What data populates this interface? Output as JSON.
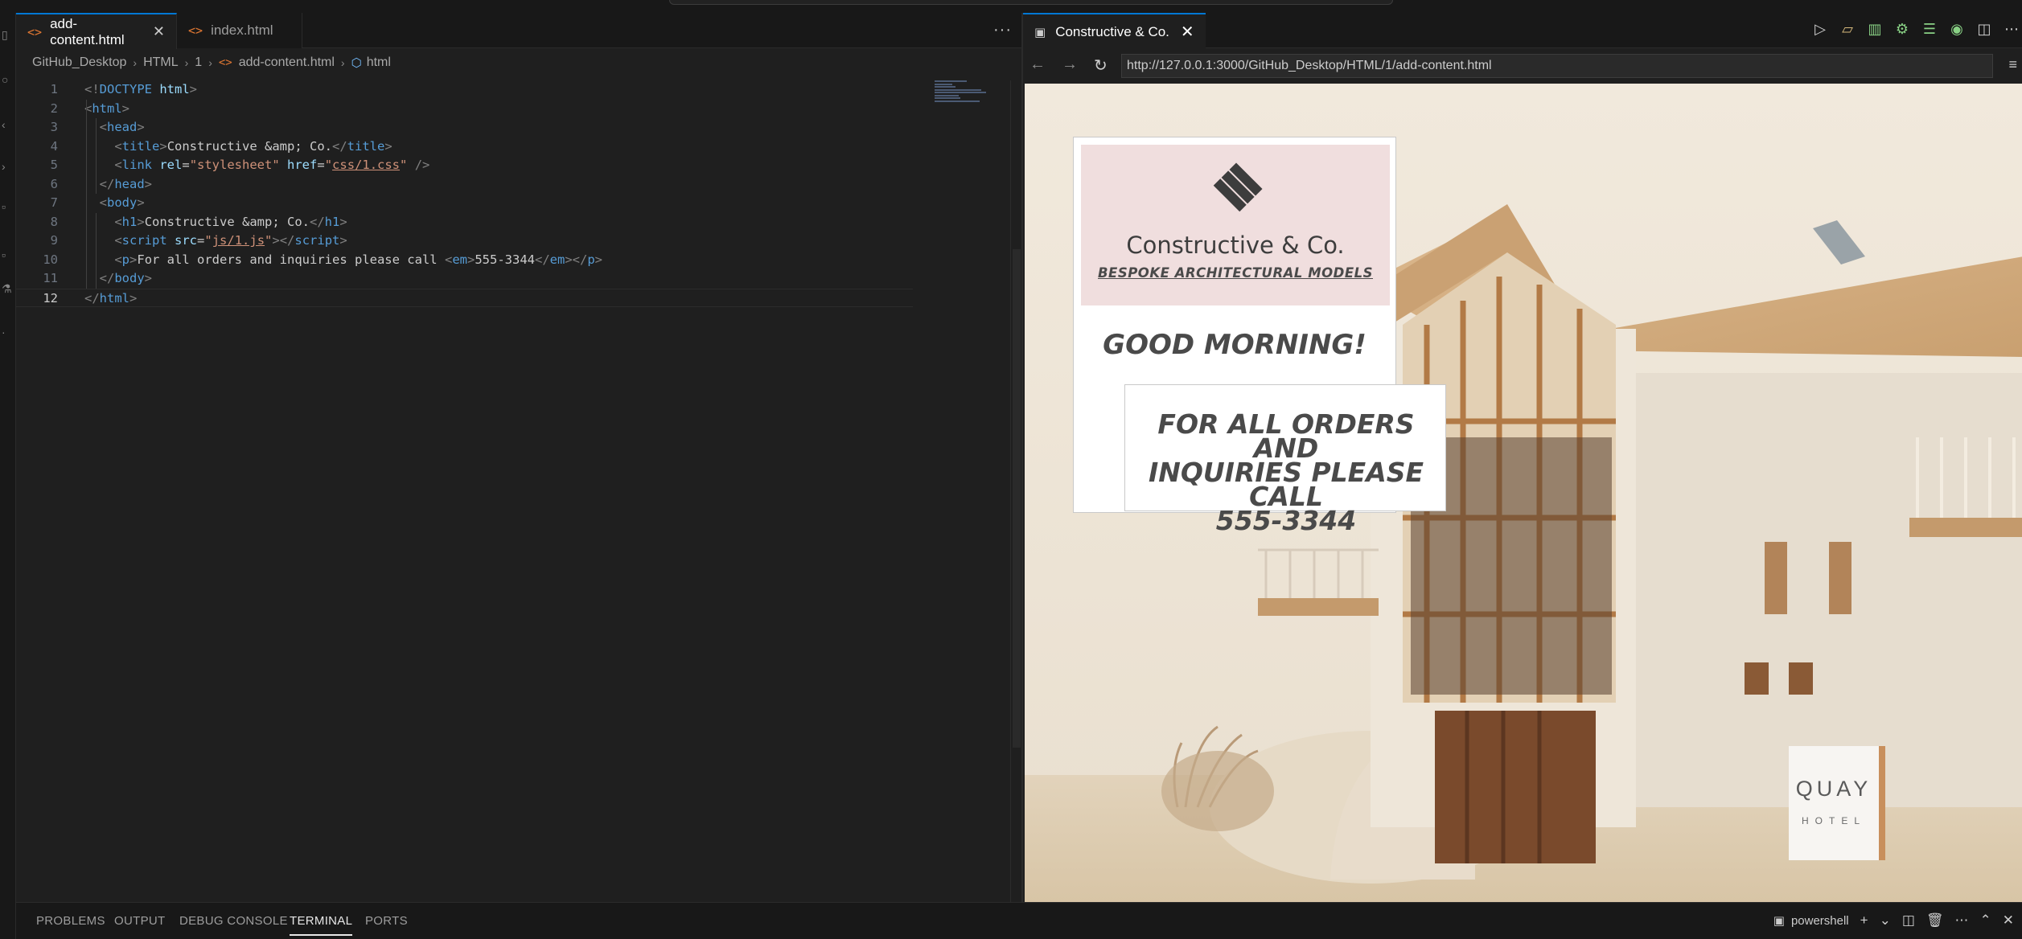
{
  "editor": {
    "tabs": [
      {
        "label": "add-content.html",
        "active": true
      },
      {
        "label": "index.html",
        "active": false
      }
    ],
    "more_label": "···",
    "breadcrumb": [
      "GitHub_Desktop",
      "HTML",
      "1",
      "add-content.html",
      "html"
    ],
    "lines": [
      {
        "n": "1",
        "parts": [
          [
            "punc",
            "<!"
          ],
          [
            "tag",
            "DOCTYPE"
          ],
          [
            "txtc",
            " "
          ],
          [
            "attr",
            "html"
          ],
          [
            "punc",
            ">"
          ]
        ]
      },
      {
        "n": "2",
        "parts": [
          [
            "punc",
            "<"
          ],
          [
            "tag",
            "html"
          ],
          [
            "punc",
            ">"
          ]
        ]
      },
      {
        "n": "3",
        "parts": [
          [
            "txtc",
            "  "
          ],
          [
            "punc",
            "<"
          ],
          [
            "tag",
            "head"
          ],
          [
            "punc",
            ">"
          ]
        ]
      },
      {
        "n": "4",
        "parts": [
          [
            "txtc",
            "    "
          ],
          [
            "punc",
            "<"
          ],
          [
            "tag",
            "title"
          ],
          [
            "punc",
            ">"
          ],
          [
            "txtc",
            "Constructive &amp; Co."
          ],
          [
            "punc",
            "</"
          ],
          [
            "tag",
            "title"
          ],
          [
            "punc",
            ">"
          ]
        ]
      },
      {
        "n": "5",
        "parts": [
          [
            "txtc",
            "    "
          ],
          [
            "punc",
            "<"
          ],
          [
            "tag",
            "link"
          ],
          [
            "txtc",
            " "
          ],
          [
            "attr",
            "rel"
          ],
          [
            "txtc",
            "="
          ],
          [
            "str",
            "\"stylesheet\""
          ],
          [
            "txtc",
            " "
          ],
          [
            "attr",
            "href"
          ],
          [
            "txtc",
            "="
          ],
          [
            "str",
            "\""
          ],
          [
            "strul",
            "css/1.css"
          ],
          [
            "str",
            "\""
          ],
          [
            "txtc",
            " "
          ],
          [
            "punc",
            "/>"
          ]
        ]
      },
      {
        "n": "6",
        "parts": [
          [
            "txtc",
            "  "
          ],
          [
            "punc",
            "</"
          ],
          [
            "tag",
            "head"
          ],
          [
            "punc",
            ">"
          ]
        ]
      },
      {
        "n": "7",
        "parts": [
          [
            "txtc",
            "  "
          ],
          [
            "punc",
            "<"
          ],
          [
            "tag",
            "body"
          ],
          [
            "punc",
            ">"
          ]
        ]
      },
      {
        "n": "8",
        "parts": [
          [
            "txtc",
            "    "
          ],
          [
            "punc",
            "<"
          ],
          [
            "tag",
            "h1"
          ],
          [
            "punc",
            ">"
          ],
          [
            "txtc",
            "Constructive &amp; Co."
          ],
          [
            "punc",
            "</"
          ],
          [
            "tag",
            "h1"
          ],
          [
            "punc",
            ">"
          ]
        ]
      },
      {
        "n": "9",
        "parts": [
          [
            "txtc",
            "    "
          ],
          [
            "punc",
            "<"
          ],
          [
            "tag",
            "script"
          ],
          [
            "txtc",
            " "
          ],
          [
            "attr",
            "src"
          ],
          [
            "txtc",
            "="
          ],
          [
            "str",
            "\""
          ],
          [
            "strul",
            "js/1.js"
          ],
          [
            "str",
            "\""
          ],
          [
            "punc",
            "></"
          ],
          [
            "tag",
            "script"
          ],
          [
            "punc",
            ">"
          ]
        ]
      },
      {
        "n": "10",
        "parts": [
          [
            "txtc",
            "    "
          ],
          [
            "punc",
            "<"
          ],
          [
            "tag",
            "p"
          ],
          [
            "punc",
            ">"
          ],
          [
            "txtc",
            "For all orders and inquiries please call "
          ],
          [
            "punc",
            "<"
          ],
          [
            "tag",
            "em"
          ],
          [
            "punc",
            ">"
          ],
          [
            "txtc",
            "555-3344"
          ],
          [
            "punc",
            "</"
          ],
          [
            "tag",
            "em"
          ],
          [
            "punc",
            "></"
          ],
          [
            "tag",
            "p"
          ],
          [
            "punc",
            ">"
          ]
        ]
      },
      {
        "n": "11",
        "parts": [
          [
            "txtc",
            "  "
          ],
          [
            "punc",
            "</"
          ],
          [
            "tag",
            "body"
          ],
          [
            "punc",
            ">"
          ]
        ]
      },
      {
        "n": "12",
        "parts": [
          [
            "punc",
            "</"
          ],
          [
            "tag",
            "html"
          ],
          [
            "punc",
            ">"
          ]
        ]
      }
    ]
  },
  "browser": {
    "tab_title": "Constructive & Co.",
    "url": "http://127.0.0.1:3000/GitHub_Desktop/HTML/1/add-content.html",
    "page": {
      "brand": "Constructive & Co.",
      "tagline": "BESPOKE ARCHITECTURAL MODELS",
      "greeting": "GOOD MORNING!",
      "message_lines": [
        "FOR ALL ORDERS AND",
        "INQUIRIES PLEASE CALL",
        "555-3344"
      ],
      "sign_name": "QUAY",
      "sign_sub": "HOTEL"
    }
  },
  "panel": {
    "tabs": [
      {
        "label": "PROBLEMS",
        "active": false
      },
      {
        "label": "OUTPUT",
        "active": false
      },
      {
        "label": "DEBUG CONSOLE",
        "active": false
      },
      {
        "label": "TERMINAL",
        "active": true
      },
      {
        "label": "PORTS",
        "active": false
      }
    ],
    "terminal_name": "powershell"
  },
  "colors": {
    "accent": "#0078d4",
    "tag": "#569cd6",
    "attr": "#9cdcfe",
    "string": "#ce9178"
  }
}
